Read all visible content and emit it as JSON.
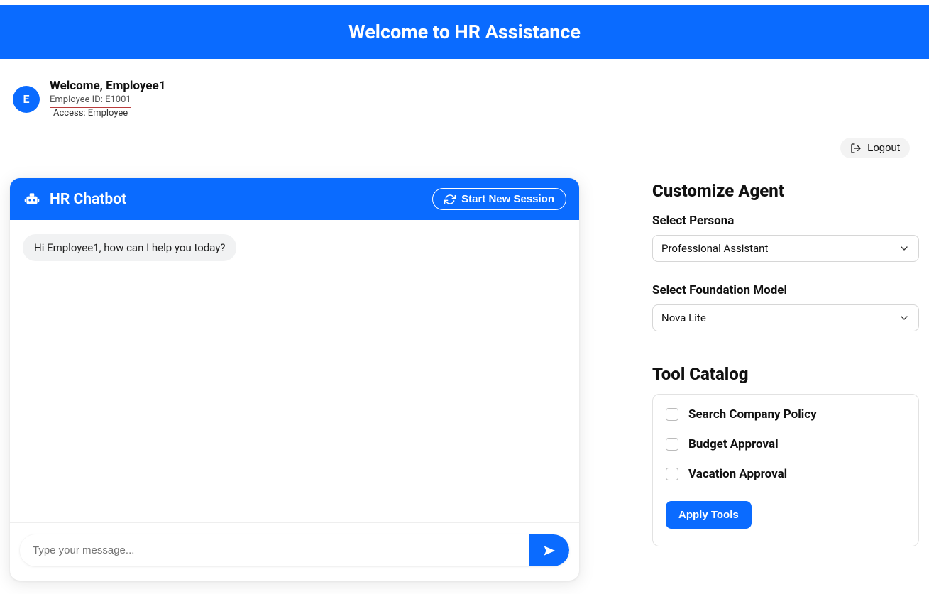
{
  "banner": {
    "title": "Welcome to HR Assistance"
  },
  "user": {
    "avatar_letter": "E",
    "welcome": "Welcome, Employee1",
    "employee_id_line": "Employee ID: E1001",
    "access_line": "Access: Employee"
  },
  "logout": {
    "label": "Logout"
  },
  "chat": {
    "title": "HR Chatbot",
    "new_session_label": "Start New Session",
    "message": "Hi Employee1, how can I help you today?",
    "input_placeholder": "Type your message..."
  },
  "customize": {
    "heading": "Customize Agent",
    "persona_label": "Select Persona",
    "persona_value": "Professional Assistant",
    "model_label": "Select Foundation Model",
    "model_value": "Nova Lite"
  },
  "tools": {
    "heading": "Tool Catalog",
    "items": [
      "Search Company Policy",
      "Budget Approval",
      "Vacation Approval"
    ],
    "apply_label": "Apply Tools"
  }
}
